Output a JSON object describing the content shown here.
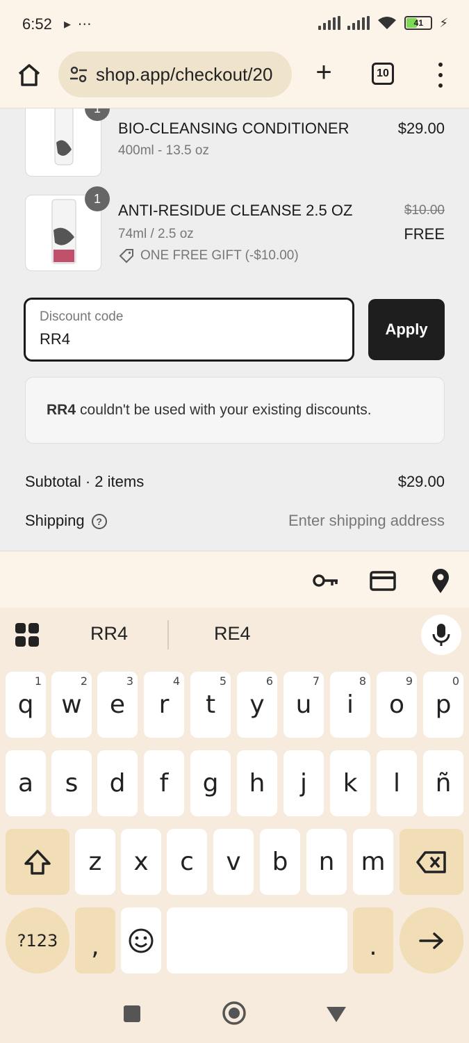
{
  "status_bar": {
    "time": "6:52",
    "extra": "▸ ⋯",
    "battery": "41"
  },
  "browser": {
    "url": "shop.app/checkout/20",
    "tab_count": "10"
  },
  "cart": {
    "items": [
      {
        "name": "BIO-CLEANSING CONDITIONER",
        "size": "400ml - 13.5 oz",
        "price": "$29.00",
        "qty": "1"
      },
      {
        "name": "ANTI-RESIDUE CLEANSE 2.5 OZ",
        "size": "74ml / 2.5 oz",
        "original_price": "$10.00",
        "price": "FREE",
        "discount_label": "ONE FREE GIFT (-$10.00)",
        "qty": "1"
      }
    ]
  },
  "discount": {
    "label": "Discount code",
    "value": "RR4",
    "apply_label": "Apply",
    "notice_code": "RR4",
    "notice_text": "couldn't be used with your existing discounts."
  },
  "summary": {
    "subtotal_label": "Subtotal · 2 items",
    "subtotal_value": "$29.00",
    "shipping_label": "Shipping",
    "shipping_value": "Enter shipping address"
  },
  "keyboard": {
    "suggestions": [
      "RR4",
      "RE4"
    ],
    "row1": [
      {
        "k": "q",
        "h": "1"
      },
      {
        "k": "w",
        "h": "2"
      },
      {
        "k": "e",
        "h": "3"
      },
      {
        "k": "r",
        "h": "4"
      },
      {
        "k": "t",
        "h": "5"
      },
      {
        "k": "y",
        "h": "6"
      },
      {
        "k": "u",
        "h": "7"
      },
      {
        "k": "i",
        "h": "8"
      },
      {
        "k": "o",
        "h": "9"
      },
      {
        "k": "p",
        "h": "0"
      }
    ],
    "row2": [
      "a",
      "s",
      "d",
      "f",
      "g",
      "h",
      "j",
      "k",
      "l",
      "ñ"
    ],
    "row3": [
      "z",
      "x",
      "c",
      "v",
      "b",
      "n",
      "m"
    ],
    "symbols_label": "?123",
    "comma": ",",
    "period": "."
  }
}
